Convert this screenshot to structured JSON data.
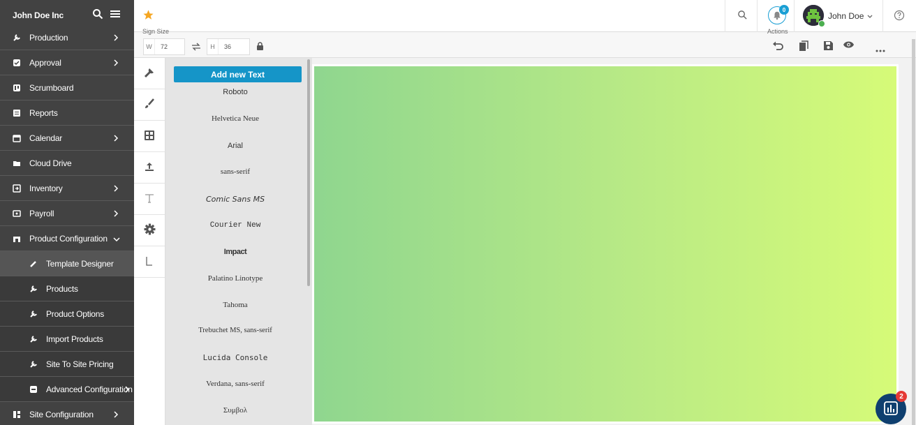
{
  "sidebar": {
    "brand": "John Doe Inc",
    "items": [
      {
        "label": "Production",
        "icon": "wrench-icon",
        "chevron": "right"
      },
      {
        "label": "Approval",
        "icon": "approval-icon",
        "chevron": "right"
      },
      {
        "label": "Scrumboard",
        "icon": "board-icon",
        "chevron": ""
      },
      {
        "label": "Reports",
        "icon": "report-icon",
        "chevron": ""
      },
      {
        "label": "Calendar",
        "icon": "calendar-icon",
        "chevron": "right"
      },
      {
        "label": "Cloud Drive",
        "icon": "folder-icon",
        "chevron": ""
      },
      {
        "label": "Inventory",
        "icon": "inventory-icon",
        "chevron": "right"
      },
      {
        "label": "Payroll",
        "icon": "payroll-icon",
        "chevron": "right"
      },
      {
        "label": "Product Configuration",
        "icon": "store-icon",
        "chevron": "down"
      }
    ],
    "subitems": [
      {
        "label": "Template Designer",
        "icon": "pencil-icon",
        "active": true
      },
      {
        "label": "Products",
        "icon": "wrench-icon"
      },
      {
        "label": "Product Options",
        "icon": "wrench-icon"
      },
      {
        "label": "Import Products",
        "icon": "wrench-icon"
      },
      {
        "label": "Site To Site Pricing",
        "icon": "wrench-icon"
      },
      {
        "label": "Advanced Configuration",
        "icon": "box-icon"
      }
    ],
    "last_item": {
      "label": "Site Configuration",
      "icon": "grid-icon",
      "chevron": "right"
    }
  },
  "header": {
    "notifications_count": "0",
    "username": "John Doe"
  },
  "toolbar": {
    "sign_size_label": "Sign Size",
    "actions_label": "Actions",
    "width_prefix": "W",
    "width_value": "72",
    "height_prefix": "H",
    "height_value": "36"
  },
  "text_panel": {
    "add_button": "Add new Text",
    "fonts": [
      "Roboto",
      "Helvetica Neue",
      "Arial",
      "sans-serif",
      "Comic Sans MS",
      "Courier New",
      "Impact",
      "Palatino Linotype",
      "Tahoma",
      "Trebuchet MS, sans-serif",
      "Lucida Console",
      "Verdana, sans-serif",
      "Συμβολ"
    ]
  },
  "chat": {
    "badge": "2"
  },
  "colors": {
    "sidebar_bg": "#424242",
    "accent": "#1595c8",
    "canvas_gradient_start": "#8fd68f",
    "canvas_gradient_end": "#d6fb78",
    "star": "#f5a623"
  }
}
